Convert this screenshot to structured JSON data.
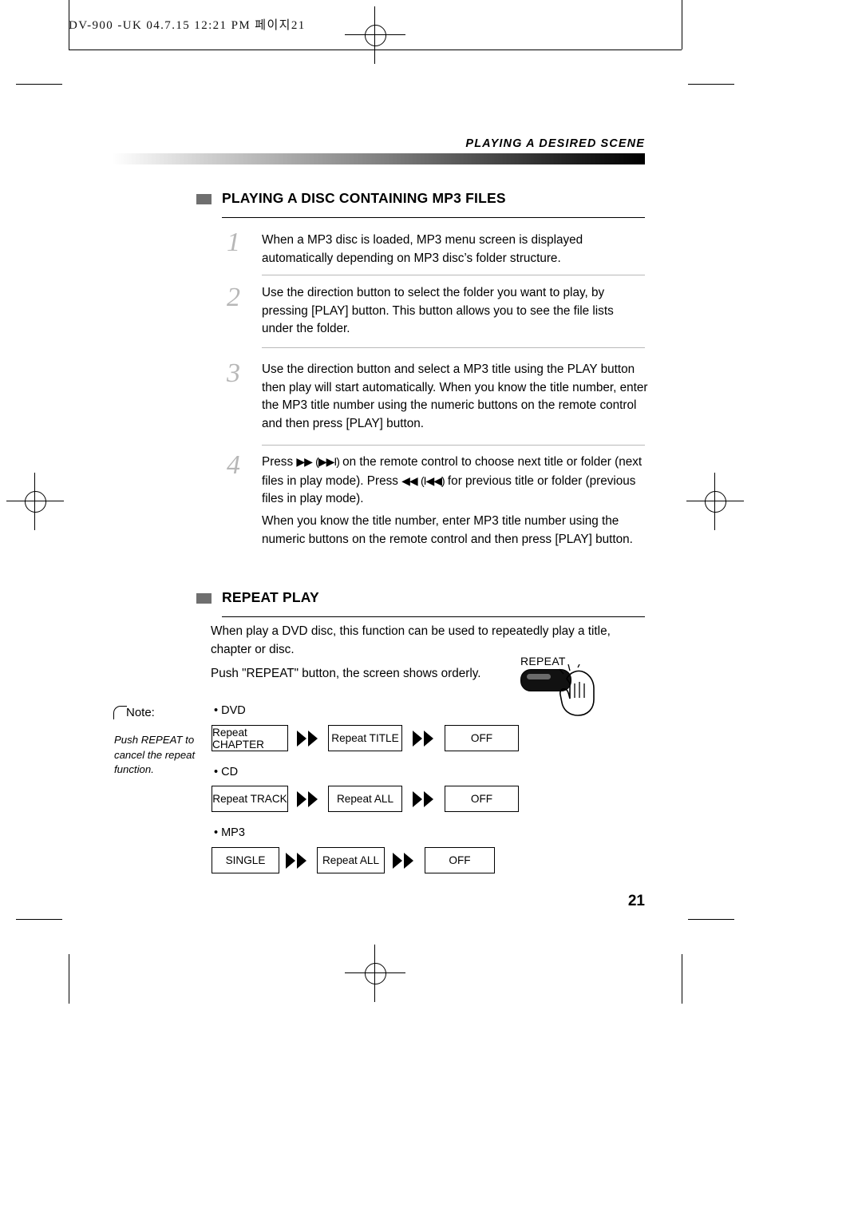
{
  "slug": "DV-900 -UK  04.7.15 12:21 PM   페이지21",
  "running_head": "PLAYING A DESIRED SCENE",
  "page_number": "21",
  "sections": [
    {
      "title": "PLAYING A DISC CONTAINING MP3 FILES",
      "steps": [
        {
          "num": "1",
          "text": "When a MP3 disc is loaded, MP3 menu screen is displayed automatically depending on MP3 disc’s folder structure."
        },
        {
          "num": "2",
          "text": "Use the direction button to select the folder you want to play, by pressing  [PLAY] button. This button allows you to see the file lists under the folder."
        },
        {
          "num": "3",
          "text": "Use the direction button and select a MP3 title using the PLAY button then play will start automatically. When you know the title number, enter the MP3 title number using the numeric buttons on the remote control and then press [PLAY] button."
        },
        {
          "num": "4",
          "text_before": "Press ",
          "icon_fwd": "▶▶",
          "icon_fwd_paren": "(▶▶I)",
          "text_mid": " on the remote control to choose next title or folder (next files in play mode). Press ",
          "icon_rev": "◀◀",
          "icon_rev_paren": "(I◀◀)",
          "text_after": " for previous title or folder (previous files in play mode).",
          "extra": "When you know the title number, enter MP3 title number using the numeric buttons on the remote control and then press [PLAY] button."
        }
      ]
    },
    {
      "title": "REPEAT PLAY",
      "intro": "When play a DVD disc, this function can be used to repeatedly play a title, chapter or disc.",
      "intro2": "Push \"REPEAT\" button, the screen shows orderly.",
      "remote_label": "REPEAT",
      "note": {
        "label": "Note:",
        "body": "Push REPEAT to cancel the repeat function."
      },
      "flows": [
        {
          "label": "• DVD",
          "boxes": [
            "Repeat CHAPTER",
            "Repeat TITLE",
            "OFF"
          ]
        },
        {
          "label": "• CD",
          "boxes": [
            "Repeat TRACK",
            "Repeat  ALL",
            "OFF"
          ]
        },
        {
          "label": "• MP3",
          "boxes": [
            "SINGLE",
            "Repeat  ALL",
            "OFF"
          ]
        }
      ]
    }
  ],
  "colors": {
    "step_number": "#b7b7b7",
    "bullet": "#6f6f6f",
    "rule": "#000000"
  }
}
